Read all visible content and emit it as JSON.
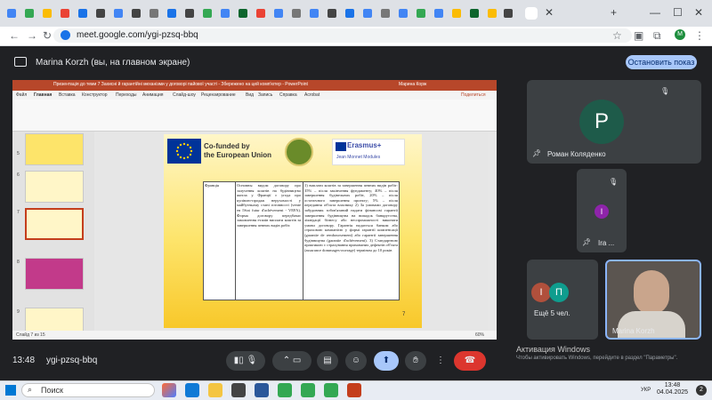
{
  "browser": {
    "url": "meet.google.com/ygi-pzsq-bbq",
    "profile_initial": "M"
  },
  "meet": {
    "presenter_banner": "Marina Korzh (вы, на главном экране)",
    "stop_button": "Остановить показ",
    "time": "13:48",
    "meeting_code": "ygi-pzsq-bbq",
    "participants": [
      {
        "name": "Роман Коляденко",
        "initial": "P",
        "color": "#1e5b4a"
      },
      {
        "name": "Ira ...",
        "initial": "I",
        "color": "#8e24aa"
      },
      {
        "name": "Ещё 5 чел.",
        "initials": [
          "I",
          "П"
        ],
        "colors": [
          "#b0503c",
          "#0f9d8e"
        ]
      },
      {
        "name": "Marina Korzh"
      }
    ]
  },
  "powerpoint": {
    "title_bar": "Презентація до теми 7 Захисні й гарантійні механізми у договорі пайової участі - Збережено на цей комп'ютер - PowerPoint",
    "user": "Марина Корж",
    "menu": [
      "Файл",
      "Главная",
      "Вставка",
      "Конструктор",
      "Переходы",
      "Анимация",
      "Слайд-шоу",
      "Рецензирование",
      "Вид",
      "Запись",
      "Справка",
      "Acrobat"
    ],
    "share_label": "Поделиться",
    "status": "Слайд 7 из 15",
    "zoom": "60%",
    "slide": {
      "cofunded_line1": "Co-funded by",
      "cofunded_line2": "the European Union",
      "erasmus": "Erasmus+",
      "monnet": "Jean Monnet Modules",
      "country": "Франція",
      "col2": "Основны видом договору про залучення коштів на будівництво житла у Франції є угода про купівлю-продаж нерухомості у майбутньому стані готовності (vente en l'état futur d'achèvement - VEFA). Форма договору передбачає замовлення етапів виплати коштів за завершення певних видів робіт.",
      "col3": "1) виплати коштів за завершення певних видів робіт: 35% – після закінчення фундаменту; 40% – після завершення будівельних робіт, 20% – після остаточного завершення проекту; 5% – після передання об'єкта власнику 2) За умовами договору забудовник зобов'язаний надати фінансові гарантії завершення будівництва на випадок банкрутства, ліквідації бізнесу або неспроможності виконати умови договору. Гарантія надається банком або страховою компанією у формі гарантії компенсації (garantie de remboursement) або гарантії завершення будівництва (garantie d'achèvement). 3) Стандартною практикою є страхування прихованих дефектів об'єкта (assurance dommages-ouvrage) терміном до 10 років",
      "page_number": "7"
    }
  },
  "windows": {
    "activation_title": "Активация Windows",
    "activation_sub": "Чтобы активировать Windows, перейдите в раздел \"Параметры\".",
    "search": "Поиск",
    "lang": "УКР",
    "clock_time": "13:48",
    "clock_date": "04.04.2025"
  },
  "colors": {
    "accent_blue": "#a8c7fa",
    "end_call_red": "#dc362e",
    "present_active": "#a8c7fa",
    "ppt_red": "#b7472a"
  }
}
